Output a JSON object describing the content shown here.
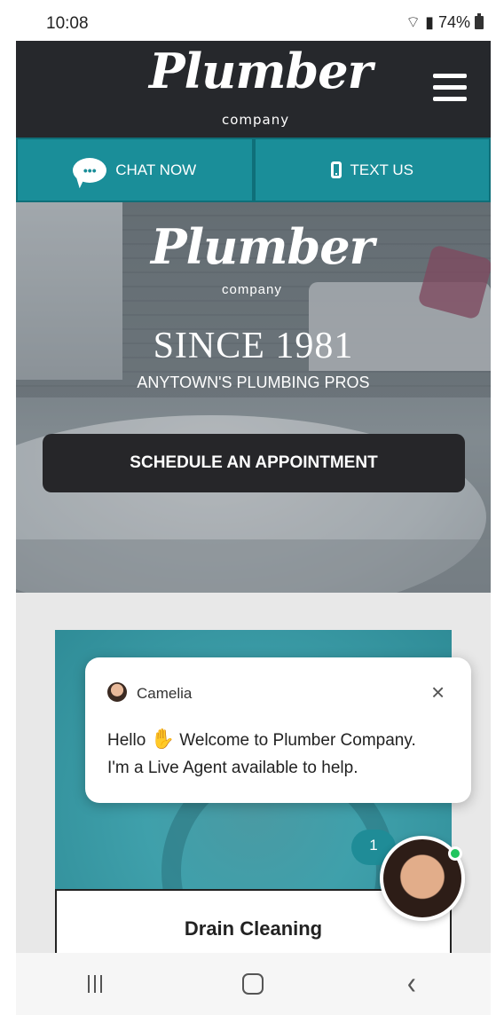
{
  "status_bar": {
    "time": "10:08",
    "battery": "74%"
  },
  "header": {
    "logo_script": "Plumber",
    "logo_sub": "company"
  },
  "cta_bar": {
    "chat_label": "CHAT NOW",
    "text_label": "TEXT US"
  },
  "hero": {
    "logo_script": "Plumber",
    "logo_sub": "company",
    "since": "SINCE 1981",
    "tagline": "ANYTOWN'S PLUMBING PROS",
    "cta_label": "SCHEDULE AN APPOINTMENT"
  },
  "service_card": {
    "title": "Drain Cleaning"
  },
  "chat_popup": {
    "agent_name": "Camelia",
    "greeting": "Hello",
    "message_line1": "Welcome to Plumber Company.",
    "message_line2": "I'm a Live Agent available to help.",
    "close": "×"
  },
  "chat_launcher": {
    "unread_count": "1"
  },
  "colors": {
    "header": "#26282c",
    "teal": "#1a8e99",
    "button": "#262629",
    "online": "#22c55e"
  },
  "icons": [
    "wifi-icon",
    "signal-icon",
    "battery-icon",
    "hamburger-menu-icon",
    "chat-bubble-icon",
    "mobile-phone-icon",
    "wave-hand-icon",
    "close-icon",
    "recents-icon",
    "home-icon",
    "back-icon"
  ]
}
